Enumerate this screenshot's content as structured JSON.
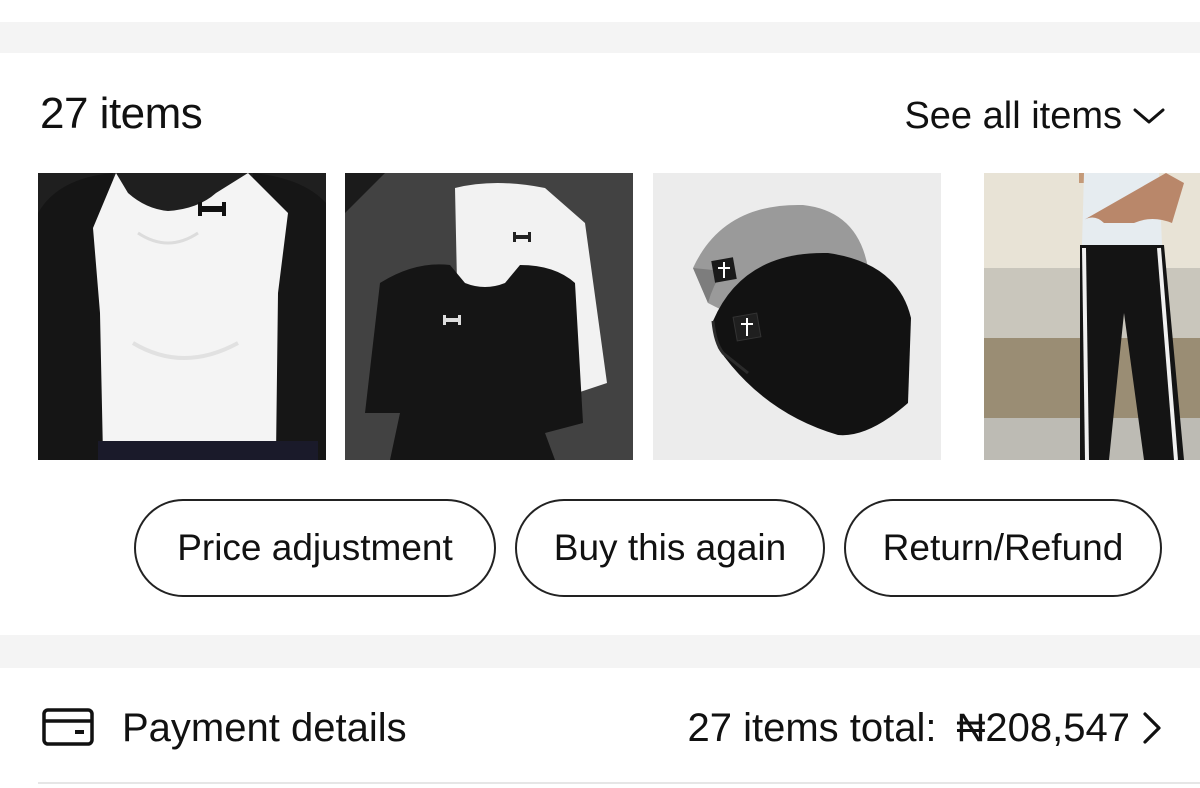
{
  "order": {
    "count_title": "27 items",
    "see_all_label": "See all items"
  },
  "thumbnails": [
    {
      "name": "white-compression-shirt"
    },
    {
      "name": "black-white-compression-shirts"
    },
    {
      "name": "gray-black-beanies"
    },
    {
      "name": "black-track-pants"
    }
  ],
  "actions": {
    "price_adjustment": "Price adjustment",
    "buy_again": "Buy this again",
    "return_refund": "Return/Refund"
  },
  "payment": {
    "label": "Payment details",
    "total_label": "27 items total:",
    "total_amount": "₦208,547"
  },
  "icons": {
    "see_all": "chevron-down-icon",
    "payment": "wallet-card-icon",
    "payment_chevron": "chevron-right-icon"
  }
}
